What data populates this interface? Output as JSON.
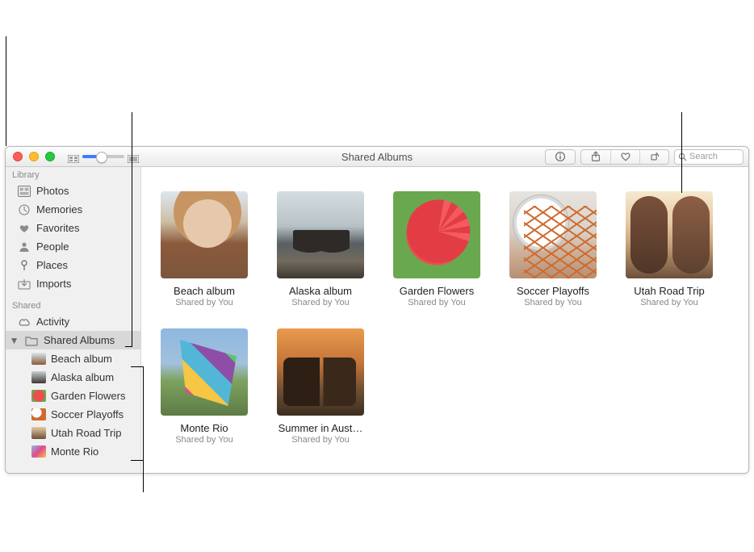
{
  "window": {
    "title": "Shared Albums",
    "search_placeholder": "Search"
  },
  "sidebar": {
    "sections": {
      "library": {
        "header": "Library",
        "items": [
          {
            "label": "Photos",
            "icon": "photos-icon"
          },
          {
            "label": "Memories",
            "icon": "memories-icon"
          },
          {
            "label": "Favorites",
            "icon": "heart-icon"
          },
          {
            "label": "People",
            "icon": "person-icon"
          },
          {
            "label": "Places",
            "icon": "pin-icon"
          },
          {
            "label": "Imports",
            "icon": "imports-icon"
          }
        ]
      },
      "shared": {
        "header": "Shared",
        "items": [
          {
            "label": "Activity",
            "icon": "cloud-icon"
          }
        ],
        "shared_albums": {
          "label": "Shared Albums",
          "expanded": true,
          "children": [
            {
              "label": "Beach album",
              "thumb": "thumb-beach"
            },
            {
              "label": "Alaska album",
              "thumb": "thumb-alaska"
            },
            {
              "label": "Garden Flowers",
              "thumb": "thumb-garden"
            },
            {
              "label": "Soccer Playoffs",
              "thumb": "thumb-soccer"
            },
            {
              "label": "Utah Road Trip",
              "thumb": "thumb-utah"
            },
            {
              "label": "Monte Rio",
              "thumb": "thumb-monte"
            }
          ]
        }
      }
    }
  },
  "content": {
    "albums": [
      {
        "title": "Beach album",
        "subtitle": "Shared by You",
        "cover": "cover-beach"
      },
      {
        "title": "Alaska album",
        "subtitle": "Shared by You",
        "cover": "cover-alaska"
      },
      {
        "title": "Garden Flowers",
        "subtitle": "Shared by You",
        "cover": "cover-garden"
      },
      {
        "title": "Soccer Playoffs",
        "subtitle": "Shared by You",
        "cover": "cover-soccer"
      },
      {
        "title": "Utah Road Trip",
        "subtitle": "Shared by You",
        "cover": "cover-utah"
      },
      {
        "title": "Monte Rio",
        "subtitle": "Shared by You",
        "cover": "cover-monte"
      },
      {
        "title": "Summer in Aust…",
        "subtitle": "Shared by You",
        "cover": "cover-summer"
      }
    ]
  }
}
